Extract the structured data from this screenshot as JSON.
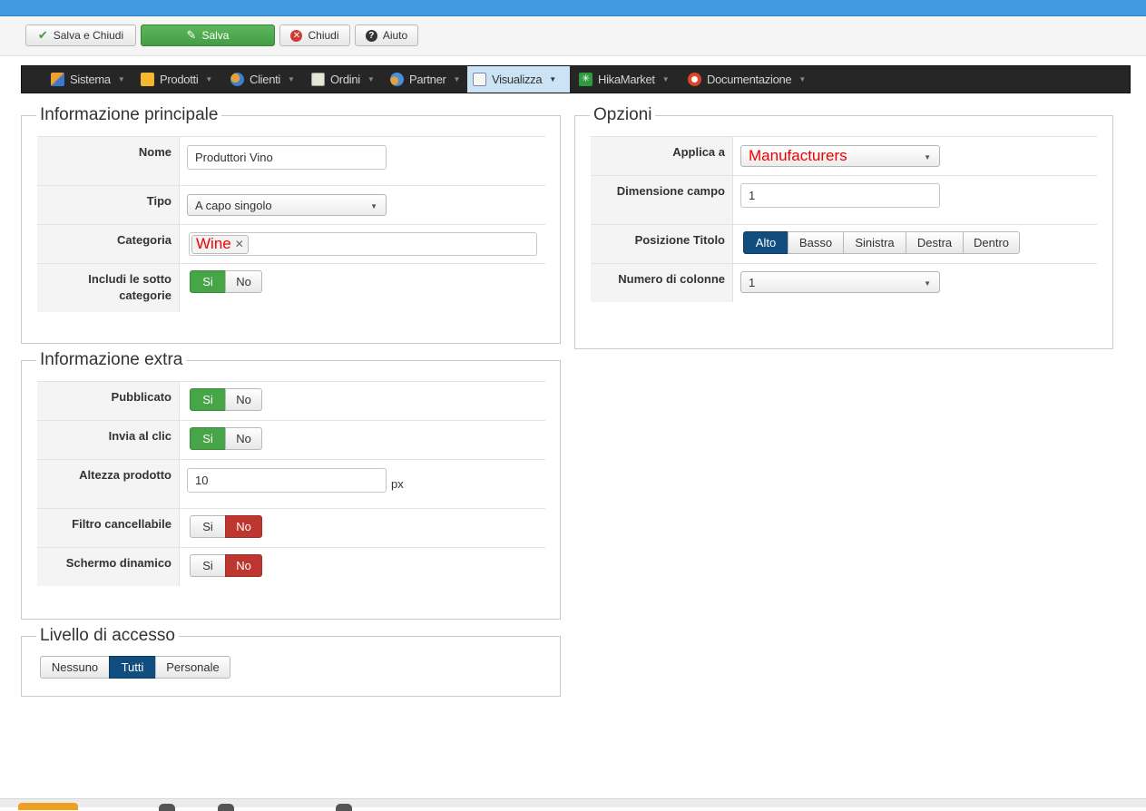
{
  "toolbar": {
    "save_close": "Salva e Chiudi",
    "save": "Salva",
    "close": "Chiudi",
    "help": "Aiuto"
  },
  "menu": {
    "items": [
      {
        "label": "Sistema",
        "icon": "tools-icon"
      },
      {
        "label": "Prodotti",
        "icon": "products-icon"
      },
      {
        "label": "Clienti",
        "icon": "customers-icon"
      },
      {
        "label": "Ordini",
        "icon": "orders-icon"
      },
      {
        "label": "Partner",
        "icon": "partner-icon"
      },
      {
        "label": "Visualizza",
        "icon": "display-icon"
      },
      {
        "label": "HikaMarket",
        "icon": "hikamarket-icon"
      },
      {
        "label": "Documentazione",
        "icon": "lifebuoy-icon"
      }
    ],
    "active_index": 5
  },
  "main_info": {
    "legend": "Informazione principale",
    "name_label": "Nome",
    "name_value": "Produttori Vino",
    "type_label": "Tipo",
    "type_value": "A capo singolo",
    "category_label": "Categoria",
    "category_tag": "Wine",
    "subcat_label": "Includi le sotto categorie",
    "yes": "Si",
    "no": "No",
    "subcat_selected": "yes"
  },
  "extra_info": {
    "legend": "Informazione extra",
    "published_label": "Pubblicato",
    "published": "yes",
    "submit_click_label": "Invia al clic",
    "submit_click": "yes",
    "height_label": "Altezza prodotto",
    "height_value": "10",
    "height_unit": "px",
    "deletable_label": "Filtro cancellabile",
    "deletable": "no",
    "dynamic_label": "Schermo dinamico",
    "dynamic": "no",
    "yes": "Si",
    "no": "No"
  },
  "access": {
    "legend": "Livello di accesso",
    "options": [
      "Nessuno",
      "Tutti",
      "Personale"
    ],
    "selected": "Tutti"
  },
  "options": {
    "legend": "Opzioni",
    "apply_label": "Applica a",
    "apply_value": "Manufacturers",
    "size_label": "Dimensione campo",
    "size_value": "1",
    "title_pos_label": "Posizione Titolo",
    "title_pos_options": [
      "Alto",
      "Basso",
      "Sinistra",
      "Destra",
      "Dentro"
    ],
    "title_pos_selected": "Alto",
    "columns_label": "Numero di colonne",
    "columns_value": "1"
  },
  "colors": {
    "topbar": "#3f9ae0",
    "menubar": "#262626",
    "active_menu": "#cbe3f5",
    "green": "#46a546",
    "red": "#bd362f",
    "blue": "#124d80",
    "tag_text": "#ee0000"
  }
}
